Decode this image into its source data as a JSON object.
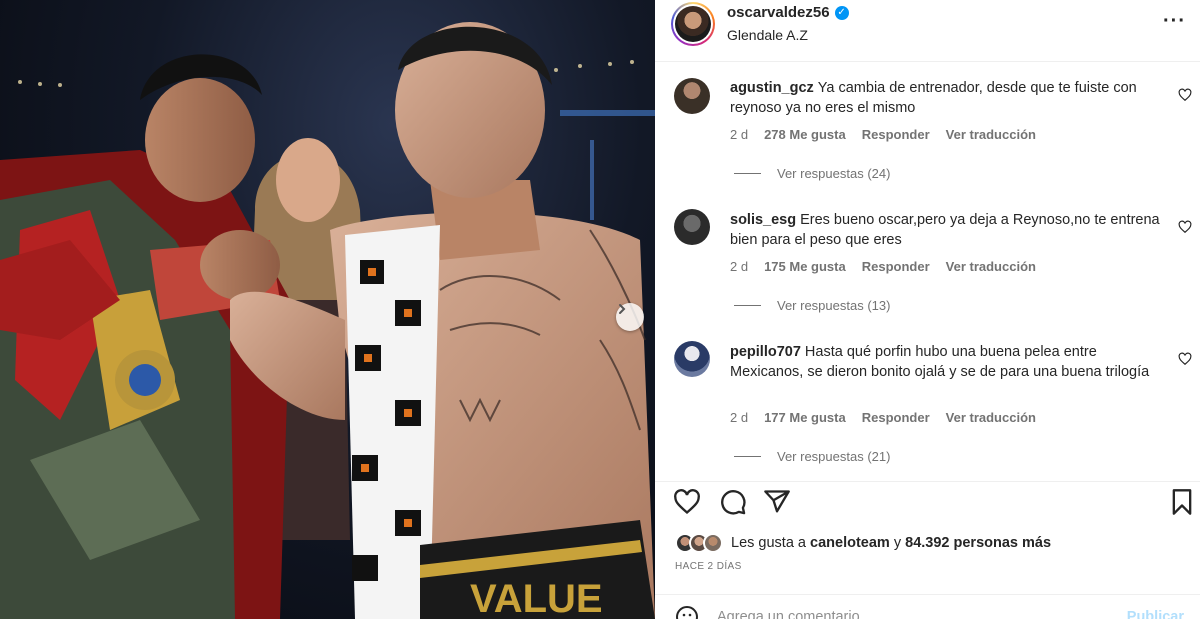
{
  "post": {
    "username": "oscarvaldez56",
    "location": "Glendale A.Z",
    "more_icon": "more-options-icon"
  },
  "comments": [
    {
      "user": "agustin_gcz",
      "text": "Ya cambia de entrenador, desde que te fuiste con reynoso ya no eres el mismo",
      "age": "2 d",
      "likes": "278 Me gusta",
      "reply": "Responder",
      "translate": "Ver traducción",
      "view_replies": "Ver respuestas (24)"
    },
    {
      "user": "solis_esg",
      "text": "Eres bueno oscar,pero ya deja a Reynoso,no te entrena bien para el peso que eres",
      "age": "2 d",
      "likes": "175 Me gusta",
      "reply": "Responder",
      "translate": "Ver traducción",
      "view_replies": "Ver respuestas (13)"
    },
    {
      "user": "pepillo707",
      "text": "Hasta qué porfin hubo una buena pelea entre Mexicanos, se dieron bonito ojalá y se de para una buena trilogía",
      "age": "2 d",
      "likes": "177 Me gusta",
      "reply": "Responder",
      "translate": "Ver traducción",
      "view_replies": "Ver respuestas (21)"
    }
  ],
  "likes": {
    "prefix": "Les gusta a",
    "liker": "caneloteam",
    "middle": "y",
    "others": "84.392 personas más"
  },
  "time_ago": "HACE 2 DÍAS",
  "composer": {
    "placeholder": "Agrega un comentario...",
    "publish": "Publicar"
  },
  "colors": {
    "link_blue": "#0095f6",
    "muted": "#737373",
    "publish_disabled": "#b2dffc"
  }
}
